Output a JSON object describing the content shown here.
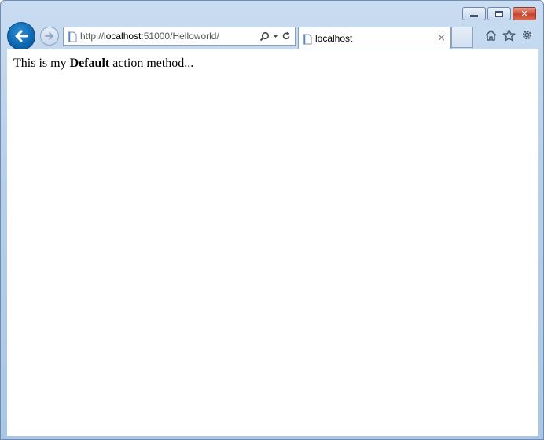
{
  "titlebar": {
    "minimize_label": "minimize",
    "maximize_label": "maximize",
    "close_label": "close",
    "close_glyph": "✕"
  },
  "nav": {
    "back_icon": "back-arrow-icon",
    "forward_icon": "forward-arrow-icon"
  },
  "address": {
    "url_prefix": "http://",
    "url_host": "localhost",
    "url_rest": ":51000/Helloworld/",
    "icons": [
      "page-icon",
      "search-icon",
      "dropdown-icon",
      "refresh-icon"
    ]
  },
  "tab": {
    "title": "localhost",
    "close_glyph": "×"
  },
  "toolbar": {
    "icons": [
      "home-icon",
      "favorites-star-icon",
      "settings-gear-icon"
    ]
  },
  "content": {
    "text_before": "This is my ",
    "text_bold": "Default",
    "text_after": " action method..."
  },
  "colors": {
    "chrome": "#b7cfe9",
    "back_button": "#0b5ea8",
    "close_button": "#c7432b",
    "page_background": "#ffffff"
  }
}
